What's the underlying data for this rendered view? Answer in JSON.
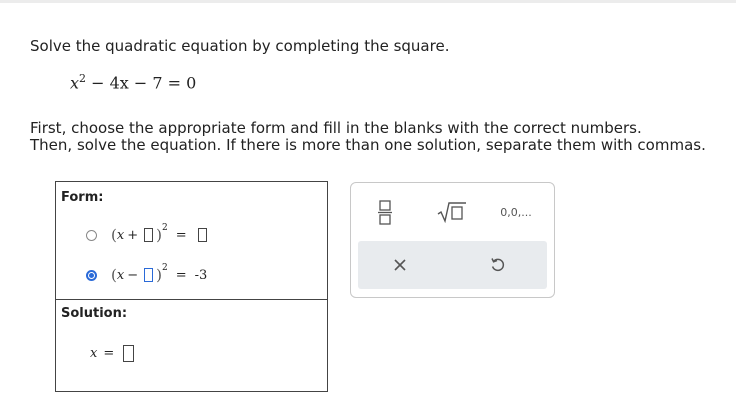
{
  "question": "Solve the quadratic equation by completing the square.",
  "equation": {
    "base": "x",
    "exp": "2",
    "rest": " − 4x − 7 = 0"
  },
  "instructions": {
    "line1": "First, choose the appropriate form and fill in the blanks with the correct numbers.",
    "line2": "Then, solve the equation. If there is more than one solution, separate them with commas."
  },
  "form": {
    "heading": "Form:",
    "options": [
      {
        "var": "x",
        "op": "+",
        "exp": "2",
        "eq": "=",
        "rhs": "",
        "selected": false
      },
      {
        "var": "x",
        "op": "−",
        "exp": "2",
        "eq": "=",
        "rhs": "-3",
        "selected": true
      }
    ]
  },
  "solution": {
    "heading": "Solution:",
    "var": "x",
    "eq": "="
  },
  "tools": {
    "fraction": "fraction-icon",
    "sqrt": "sqrt-icon",
    "list": "list-icon",
    "list_label": "0,0,...",
    "clear": "close-icon",
    "undo": "undo-icon"
  },
  "colors": {
    "accent": "#2a6ad8"
  }
}
